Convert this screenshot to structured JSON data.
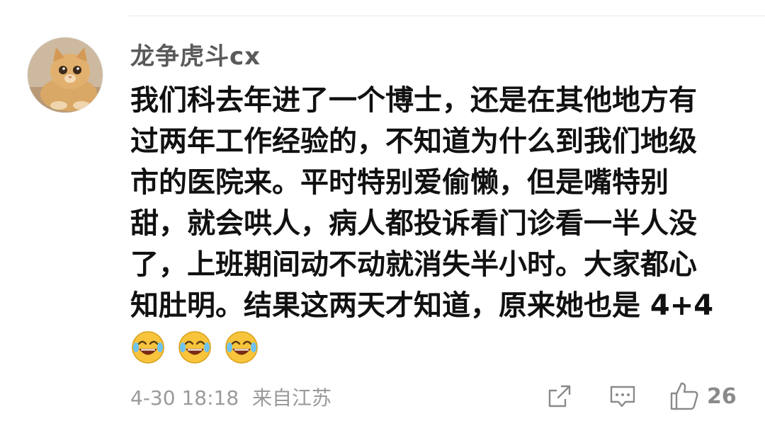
{
  "comment": {
    "username": "龙争虎斗cx",
    "lines": [
      "我们科去年进了一个博士，还是在其他地方有",
      "过两年工作经验的，不知道为什么到我们地级",
      "市的医院来。平时特别爱偷懒，但是嘴特别",
      "甜，就会哄人，病人都投诉看门诊看一半人没",
      "了，上班期间动不动就消失半小时。大家都心",
      "知肚明。结果这两天才知道，原来她也是 4+4"
    ],
    "emojis": [
      "laughing-crying-emoji",
      "laughing-crying-emoji",
      "laughing-crying-emoji"
    ],
    "timestamp": "4-30 18:18",
    "location": "来自江苏",
    "like_count": "26"
  },
  "icons": {
    "avatar": "cat-avatar",
    "share": "share-icon",
    "reply": "comment-icon",
    "like": "thumbs-up-icon"
  },
  "colors": {
    "username": "#5a5a5a",
    "text": "#111111",
    "meta": "#9a9a9a",
    "icon": "#8a8a8a"
  }
}
